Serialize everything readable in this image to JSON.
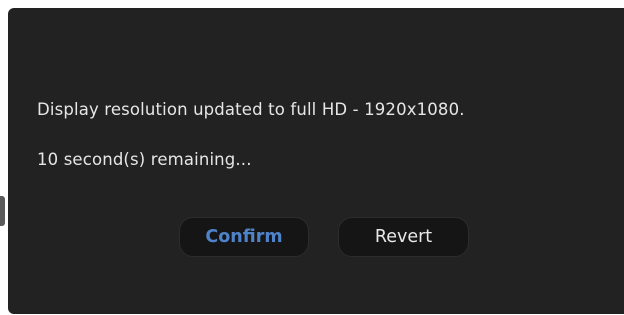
{
  "dialog": {
    "message_line_1": "Display resolution updated to full HD - 1920x1080.",
    "message_line_2": "10 second(s) remaining...",
    "countdown_seconds": 10
  },
  "buttons": {
    "confirm_label": "Confirm",
    "revert_label": "Revert"
  },
  "colors": {
    "dialog_background": "#222222",
    "button_background": "#151515",
    "confirm_text": "#4f83c9",
    "revert_text": "#e8e8e8",
    "message_text": "#e6e6e6"
  }
}
